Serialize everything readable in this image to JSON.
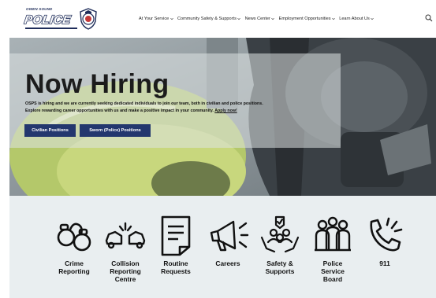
{
  "brand": {
    "small_text": "OWEN SOUND",
    "main_text": "POLICE"
  },
  "nav": {
    "items": [
      {
        "label": "At Your Service",
        "icon": "chevron-down-icon"
      },
      {
        "label": "Community Safety & Supports",
        "icon": "chevron-down-icon"
      },
      {
        "label": "News Center",
        "icon": "chevron-down-icon"
      },
      {
        "label": "Employment Opportunities",
        "icon": "chevron-down-icon"
      },
      {
        "label": "Learn About Us",
        "icon": "chevron-down-icon"
      }
    ],
    "search_icon": "search-icon"
  },
  "hero": {
    "title": "Now Hiring",
    "line1": "OSPS is hiring and we are currently seeking dedicated individuals to join our team, both in civilian and police positions.",
    "line2": "Explore rewarding career opportunities with us and make a positive impact in your community.",
    "apply_link": "Apply now!",
    "buttons": {
      "civilian": "Civilian Positions",
      "sworn": "Sworn (Police) Positions"
    }
  },
  "quick_links": [
    {
      "label": "Crime\nReporting",
      "icon": "handcuffs-icon"
    },
    {
      "label": "Collision\nReporting\nCentre",
      "icon": "car-collision-icon"
    },
    {
      "label": "Routine\nRequests",
      "icon": "document-icon"
    },
    {
      "label": "Careers",
      "icon": "megaphone-icon"
    },
    {
      "label": "Safety &\nSupports",
      "icon": "community-care-icon"
    },
    {
      "label": "Police\nService\nBoard",
      "icon": "board-members-icon"
    },
    {
      "label": "911",
      "icon": "phone-icon"
    }
  ],
  "colors": {
    "navy": "#23376e",
    "panel": "#e9eef0"
  }
}
